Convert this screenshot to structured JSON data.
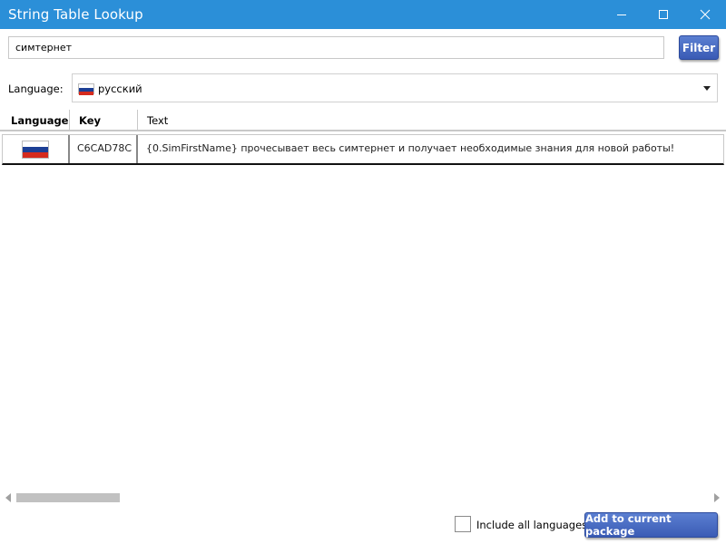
{
  "window": {
    "title": "String Table Lookup",
    "controls": [
      "minimize-icon",
      "maximize-icon",
      "close-icon"
    ],
    "titlebar_color": "#2b8fd8"
  },
  "search": {
    "value": "симтернет",
    "filter_label": "Filter"
  },
  "language": {
    "label": "Language:",
    "selected": "русский",
    "flag": "russia-flag-icon"
  },
  "table": {
    "columns": [
      "Language",
      "Key",
      "Text"
    ],
    "rows": [
      {
        "language_flag": "russia-flag-icon",
        "key": "C6CAD78C",
        "text": "{0.SimFirstName} прочесывает весь симтернет и получает необходимые знания для новой работы!"
      }
    ]
  },
  "footer": {
    "include_all_languages_label": "Include all languages",
    "include_all_languages_checked": false,
    "add_button_label": "Add to current package"
  },
  "colors": {
    "accent_button": "#4a6cc4",
    "flag_white": "#ffffff",
    "flag_blue": "#1c3f95",
    "flag_red": "#d52b1e"
  }
}
